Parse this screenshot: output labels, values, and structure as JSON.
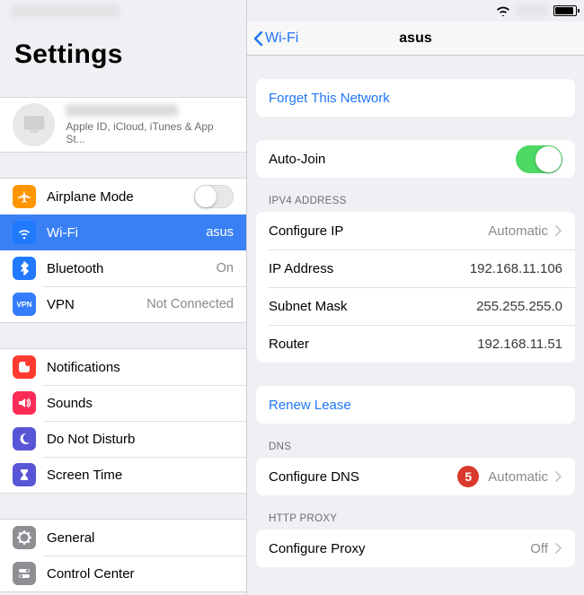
{
  "statusbar": {},
  "left": {
    "title": "Settings",
    "user": {
      "subtitle": "Apple ID, iCloud, iTunes & App St..."
    },
    "groups": [
      [
        {
          "key": "airplane",
          "label": "Airplane Mode",
          "value": "",
          "icon": "airplane",
          "color": "bg-orange",
          "switch_off": true
        },
        {
          "key": "wifi",
          "label": "Wi-Fi",
          "value": "asus",
          "icon": "wifi",
          "color": "bg-blue",
          "selected": true
        },
        {
          "key": "bluetooth",
          "label": "Bluetooth",
          "value": "On",
          "icon": "bluetooth",
          "color": "bg-blue"
        },
        {
          "key": "vpn",
          "label": "VPN",
          "value": "Not Connected",
          "icon": "vpn",
          "color": "bg-vpnblue"
        }
      ],
      [
        {
          "key": "notifications",
          "label": "Notifications",
          "value": "",
          "icon": "notifications",
          "color": "bg-red"
        },
        {
          "key": "sounds",
          "label": "Sounds",
          "value": "",
          "icon": "sounds",
          "color": "bg-pink"
        },
        {
          "key": "dnd",
          "label": "Do Not Disturb",
          "value": "",
          "icon": "moon",
          "color": "bg-indigo"
        },
        {
          "key": "screentime",
          "label": "Screen Time",
          "value": "",
          "icon": "hourglass",
          "color": "bg-indigo"
        }
      ],
      [
        {
          "key": "general",
          "label": "General",
          "value": "",
          "icon": "gear",
          "color": "bg-grey"
        },
        {
          "key": "controlcenter",
          "label": "Control Center",
          "value": "",
          "icon": "switch",
          "color": "bg-grey"
        }
      ]
    ]
  },
  "detail": {
    "back_label": "Wi-Fi",
    "title": "asus",
    "forget_label": "Forget This Network",
    "autojoin_label": "Auto-Join",
    "autojoin_on": true,
    "ipv4_header": "IPV4 ADDRESS",
    "ipv4": {
      "configure_ip_label": "Configure IP",
      "configure_ip_value": "Automatic",
      "ip_label": "IP Address",
      "ip_value": "192.168.11.106",
      "subnet_label": "Subnet Mask",
      "subnet_value": "255.255.255.0",
      "router_label": "Router",
      "router_value": "192.168.11.51"
    },
    "renew_label": "Renew Lease",
    "dns_header": "DNS",
    "dns": {
      "configure_label": "Configure DNS",
      "configure_value": "Automatic",
      "callout": "5"
    },
    "proxy_header": "HTTP PROXY",
    "proxy": {
      "configure_label": "Configure Proxy",
      "configure_value": "Off"
    }
  }
}
